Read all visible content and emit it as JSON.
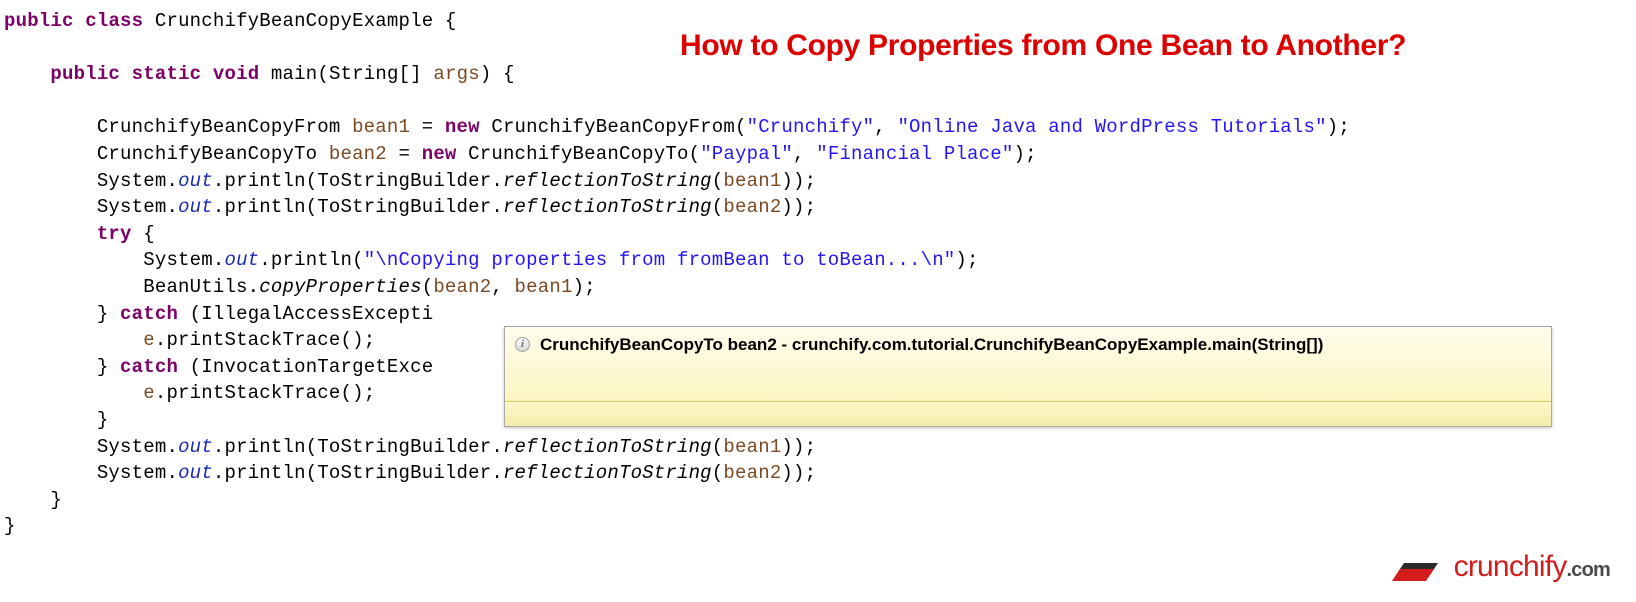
{
  "title": "How to Copy Properties from One Bean to Another?",
  "code": {
    "kw_public": "public",
    "kw_class": "class",
    "class_name": "CrunchifyBeanCopyExample",
    "kw_static": "static",
    "kw_void": "void",
    "method_main": "main",
    "param_type": "String[]",
    "param_name": "args",
    "type_from": "CrunchifyBeanCopyFrom",
    "var_bean1": "bean1",
    "kw_new": "new",
    "str_crunchify": "\"Crunchify\"",
    "str_tutorials": "\"Online Java and WordPress Tutorials\"",
    "type_to": "CrunchifyBeanCopyTo",
    "var_bean2": "bean2",
    "str_paypal": "\"Paypal\"",
    "str_financial": "\"Financial Place\"",
    "sys": "System",
    "out": "out",
    "println": "println",
    "tsb": "ToStringBuilder",
    "rts": "reflectionToString",
    "kw_try": "try",
    "str_copying": "\"\\nCopying properties from fromBean to toBean...\\n\"",
    "beanutils": "BeanUtils",
    "copyProps": "copyProperties",
    "kw_catch": "catch",
    "exc1_partial": "IllegalAccessExcepti",
    "var_e": "e",
    "pst": "printStackTrace",
    "exc2_partial": "InvocationTargetExce"
  },
  "tooltip": {
    "text": "CrunchifyBeanCopyTo bean2 - crunchify.com.tutorial.CrunchifyBeanCopyExample.main(String[])"
  },
  "logo": {
    "brand": "crunchify",
    "tld": ".com"
  }
}
